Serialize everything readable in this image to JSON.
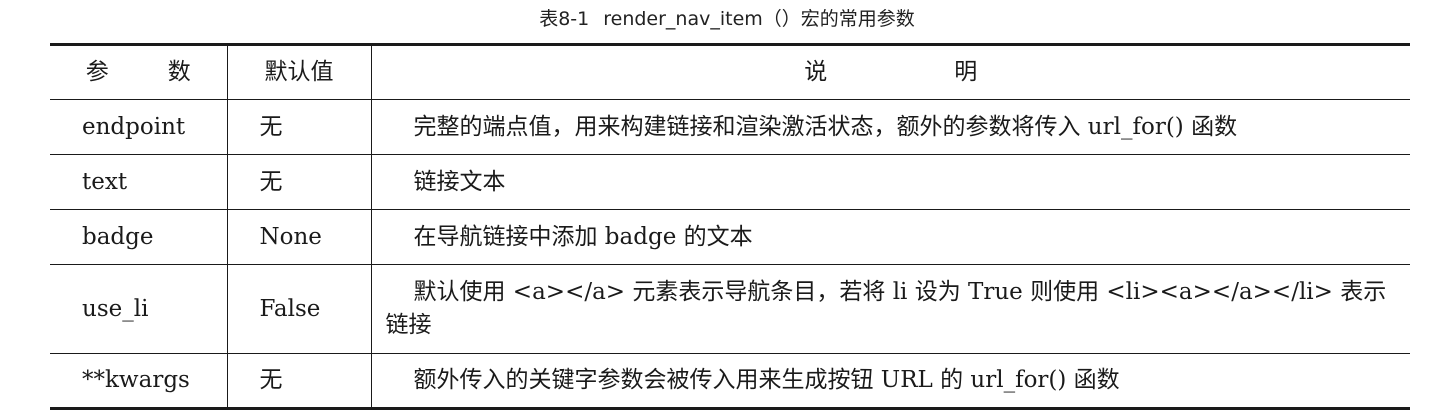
{
  "caption": {
    "number": "表8-1",
    "title": "render_nav_item（）宏的常用参数"
  },
  "table": {
    "headers": [
      "参　数",
      "默认值",
      "说　明"
    ],
    "rows": [
      {
        "param": "endpoint",
        "default": "无",
        "description": "完整的端点值，用来构建链接和渲染激活状态，额外的参数将传入 url_for() 函数"
      },
      {
        "param": "text",
        "default": "无",
        "description": "链接文本"
      },
      {
        "param": "badge",
        "default": "None",
        "description": "在导航链接中添加 badge 的文本"
      },
      {
        "param": "use_li",
        "default": "False",
        "description": "默认使用 <a></a> 元素表示导航条目，若将 li 设为 True 则使用 <li><a></a></li> 表示链接"
      },
      {
        "param": "**kwargs",
        "default": "无",
        "description": "额外传入的关键字参数会被传入用来生成按钮 URL 的 url_for() 函数"
      }
    ]
  }
}
